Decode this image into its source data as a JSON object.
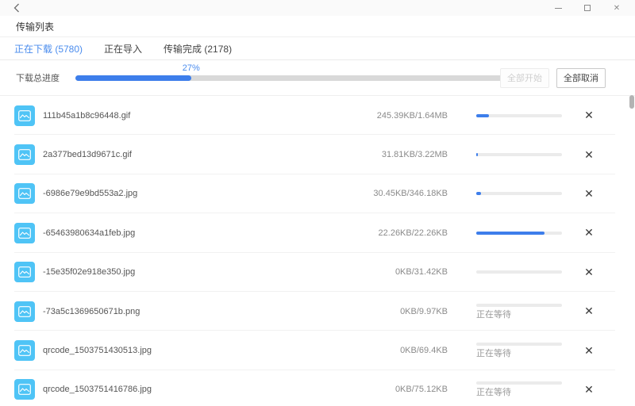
{
  "window": {
    "icons": {
      "back": "back-chevron",
      "minimize": "minimize",
      "maximize": "maximize",
      "close": "✕"
    }
  },
  "header": {
    "title": "传输列表"
  },
  "tabs": [
    {
      "label": "正在下载 (5780)",
      "active": true
    },
    {
      "label": "正在导入",
      "active": false
    },
    {
      "label": "传输完成 (2178)",
      "active": false
    }
  ],
  "overall": {
    "label": "下载总进度",
    "percent_text": "27%",
    "percent": 27,
    "start_all_label": "全部开始",
    "start_all_enabled": false,
    "cancel_all_label": "全部取消",
    "cancel_all_enabled": true
  },
  "colors": {
    "accent_blue": "#4a8cee",
    "progress_fill": "#3d7eeb",
    "file_icon_blue": "#4fc4f6"
  },
  "row_close_glyph": "✕",
  "files": [
    {
      "name": "111b45a1b8c96448.gif",
      "size": "245.39KB/1.64MB",
      "progress": 15,
      "status": ""
    },
    {
      "name": "2a377bed13d9671c.gif",
      "size": "31.81KB/3.22MB",
      "progress": 2,
      "status": ""
    },
    {
      "name": "-6986e79e9bd553a2.jpg",
      "size": "30.45KB/346.18KB",
      "progress": 6,
      "status": ""
    },
    {
      "name": "-65463980634a1feb.jpg",
      "size": "22.26KB/22.26KB",
      "progress": 80,
      "status": ""
    },
    {
      "name": "-15e35f02e918e350.jpg",
      "size": "0KB/31.42KB",
      "progress": 0,
      "status": ""
    },
    {
      "name": "-73a5c1369650671b.png",
      "size": "0KB/9.97KB",
      "progress": 0,
      "status": "正在等待"
    },
    {
      "name": "qrcode_1503751430513.jpg",
      "size": "0KB/69.4KB",
      "progress": 0,
      "status": "正在等待"
    },
    {
      "name": "qrcode_1503751416786.jpg",
      "size": "0KB/75.12KB",
      "progress": 0,
      "status": "正在等待"
    }
  ]
}
